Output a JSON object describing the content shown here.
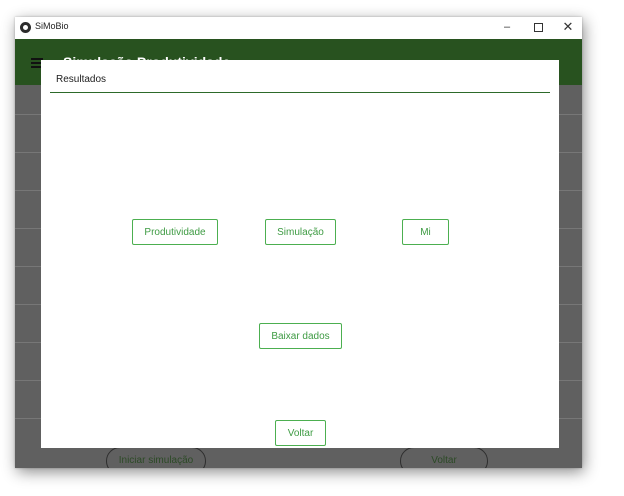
{
  "window": {
    "title": "SiMoBio",
    "minimize": "–",
    "close": "✕"
  },
  "appbar": {
    "title_fragment": "Simulação Produtividade..."
  },
  "background_buttons": {
    "start": "Iniciar simulação",
    "back": "Voltar"
  },
  "dialog": {
    "title": "Resultados",
    "buttons": {
      "produtividade": "Produtividade",
      "simulacao": "Simulação",
      "mi": "Mi",
      "baixar": "Baixar dados",
      "voltar": "Voltar"
    }
  },
  "colors": {
    "accent": "#4caf50",
    "appbar": "#28521f",
    "overlay": "#606060"
  },
  "icons": {
    "app": "app-logo-icon",
    "menu": "hamburger-menu-icon"
  }
}
